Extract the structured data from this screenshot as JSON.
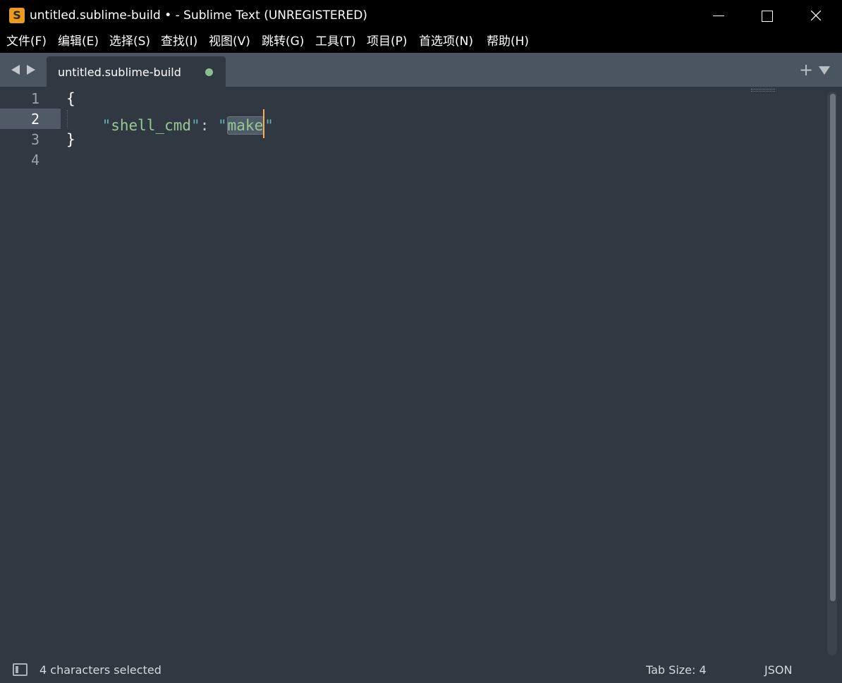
{
  "window": {
    "title": "untitled.sublime-build • - Sublime Text (UNREGISTERED)",
    "app_icon_glyph": "S",
    "controls": [
      "minimize-icon",
      "maximize-icon",
      "close-icon"
    ]
  },
  "menu": {
    "items": [
      {
        "label": "文件(F)"
      },
      {
        "label": "编辑(E)"
      },
      {
        "label": "选择(S)"
      },
      {
        "label": "查找(I)"
      },
      {
        "label": "视图(V)"
      },
      {
        "label": "跳转(G)"
      },
      {
        "label": "工具(T)"
      },
      {
        "label": "项目(P)"
      },
      {
        "label": "首选项(N)"
      },
      {
        "label": "帮助(H)"
      }
    ]
  },
  "tabs": {
    "active": {
      "label": "untitled.sublime-build",
      "modified": true
    },
    "new_tab_symbol": "+"
  },
  "editor": {
    "line_numbers": [
      "1",
      "2",
      "3",
      "4"
    ],
    "current_line": 2,
    "lines": {
      "open_brace": "{",
      "key": "shell_cmd",
      "value": "make",
      "close_brace": "}"
    },
    "quote": "\"",
    "colon": ": "
  },
  "status": {
    "selection": "4 characters selected",
    "tab_size": "Tab Size: 4",
    "syntax": "JSON"
  },
  "colors": {
    "background": "#303841",
    "tab_bar": "#4b5560",
    "string": "#99c794",
    "quote": "#5fb3b3",
    "caret": "#f9ae58",
    "dirty_dot": "#8cbf8e"
  }
}
